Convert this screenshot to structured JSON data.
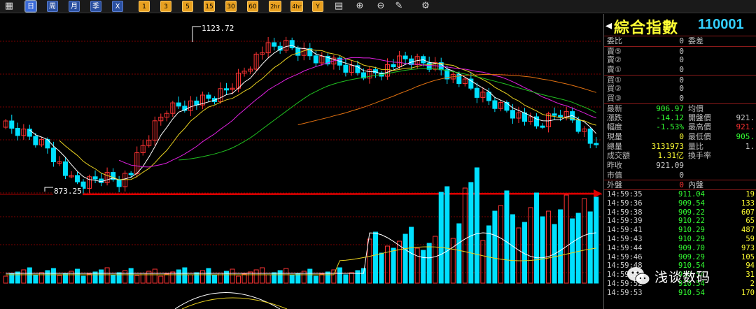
{
  "toolbar": {
    "buttons": [
      {
        "id": "calendar",
        "label": "▦",
        "style": "plain"
      },
      {
        "id": "day",
        "label": "日",
        "style": "blue",
        "active": true
      },
      {
        "id": "week",
        "label": "周",
        "style": "blue"
      },
      {
        "id": "month",
        "label": "月",
        "style": "blue"
      },
      {
        "id": "season",
        "label": "季",
        "style": "blue"
      },
      {
        "id": "x",
        "label": "X",
        "style": "blue"
      },
      {
        "id": "m1",
        "label": "1",
        "style": "orange"
      },
      {
        "id": "m3",
        "label": "3",
        "style": "orange"
      },
      {
        "id": "m5",
        "label": "5",
        "style": "orange"
      },
      {
        "id": "m15",
        "label": "15",
        "style": "orange"
      },
      {
        "id": "m30",
        "label": "30",
        "style": "orange"
      },
      {
        "id": "m60",
        "label": "60",
        "style": "orange"
      },
      {
        "id": "h2",
        "label": "2hr",
        "style": "orange"
      },
      {
        "id": "h4",
        "label": "4hr",
        "style": "orange"
      },
      {
        "id": "year",
        "label": "Y",
        "style": "orange"
      },
      {
        "id": "indicator",
        "label": "▤",
        "style": "plain"
      },
      {
        "id": "zoom-in",
        "label": "⊕",
        "style": "plain"
      },
      {
        "id": "zoom-out",
        "label": "⊖",
        "style": "plain"
      },
      {
        "id": "draw",
        "label": "✎",
        "style": "plain"
      },
      {
        "id": "settings",
        "label": "⚙",
        "style": "plain"
      }
    ]
  },
  "chart": {
    "high_label": "1123.72",
    "low_label": "873.25",
    "colors": {
      "up": "#ff3333",
      "down": "#00e0ff",
      "ma5": "#ffffff",
      "ma10": "#e8d020",
      "ma20": "#e020e0",
      "ma60": "#20c020",
      "ma120": "#e07010",
      "arrow": "#e00000",
      "grid": "#7a0000"
    }
  },
  "panel": {
    "name": "綜合指數",
    "code": "110001",
    "order_rows": [
      {
        "label": "委比",
        "value": "0",
        "label2": "委差",
        "value2": ""
      },
      {
        "label": "賣⑤",
        "value": "0",
        "label2": "",
        "value2": ""
      },
      {
        "label": "賣②",
        "value": "0",
        "label2": "",
        "value2": ""
      },
      {
        "label": "賣①",
        "value": "0",
        "label2": "",
        "value2": ""
      },
      {
        "label": "買①",
        "value": "0",
        "label2": "",
        "value2": ""
      },
      {
        "label": "買②",
        "value": "0",
        "label2": "",
        "value2": ""
      },
      {
        "label": "買③",
        "value": "0",
        "label2": "",
        "value2": ""
      }
    ],
    "stat_rows": [
      {
        "label": "最新",
        "value": "906.97",
        "vcolor": "#33ff33",
        "label2": "均價",
        "value2": "",
        "v2color": "#ccc"
      },
      {
        "label": "漲跌",
        "value": "-14.12",
        "vcolor": "#33ff33",
        "label2": "開盤價",
        "value2": "921.",
        "v2color": "#ccc"
      },
      {
        "label": "幅度",
        "value": "-1.53%",
        "vcolor": "#33ff33",
        "label2": "最高價",
        "value2": "921.",
        "v2color": "#ff3333"
      },
      {
        "label": "現量",
        "value": "0",
        "vcolor": "#ffff33",
        "label2": "最低價",
        "value2": "905.",
        "v2color": "#33ff33"
      },
      {
        "label": "總量",
        "value": "3131973",
        "vcolor": "#ffff33",
        "label2": "量比",
        "value2": "1.",
        "v2color": "#ccc"
      },
      {
        "label": "成交額",
        "value": "1.31亿",
        "vcolor": "#ffff33",
        "label2": "換手率",
        "value2": "",
        "v2color": "#ccc"
      },
      {
        "label": "昨收",
        "value": "921.09",
        "vcolor": "#ccc",
        "label2": "",
        "value2": "",
        "v2color": "#ccc"
      },
      {
        "label": "市值",
        "value": "0",
        "vcolor": "#ccc",
        "label2": "",
        "value2": "",
        "v2color": "#ccc"
      },
      {
        "label": "外盤",
        "value": "0",
        "vcolor": "#ff3333",
        "label2": "內盤",
        "value2": "",
        "v2color": "#ccc"
      }
    ],
    "ticks": [
      {
        "t": "14:59:35",
        "p": "911.04",
        "v": "19"
      },
      {
        "t": "14:59:36",
        "p": "909.54",
        "v": "133"
      },
      {
        "t": "14:59:38",
        "p": "909.22",
        "v": "607"
      },
      {
        "t": "14:59:39",
        "p": "910.22",
        "v": "65"
      },
      {
        "t": "14:59:41",
        "p": "910.29",
        "v": "487"
      },
      {
        "t": "14:59:43",
        "p": "910.29",
        "v": "59"
      },
      {
        "t": "14:59:44",
        "p": "909.70",
        "v": "973"
      },
      {
        "t": "14:59:46",
        "p": "909.29",
        "v": "105"
      },
      {
        "t": "14:59:48",
        "p": "910.54",
        "v": "94"
      },
      {
        "t": "14:59:50",
        "p": "910.54",
        "v": "31"
      },
      {
        "t": "14:59:52",
        "p": "910.54",
        "v": "2"
      },
      {
        "t": "14:59:53",
        "p": "910.54",
        "v": "170"
      }
    ]
  },
  "watermark": {
    "text": "浅谈数码"
  }
}
